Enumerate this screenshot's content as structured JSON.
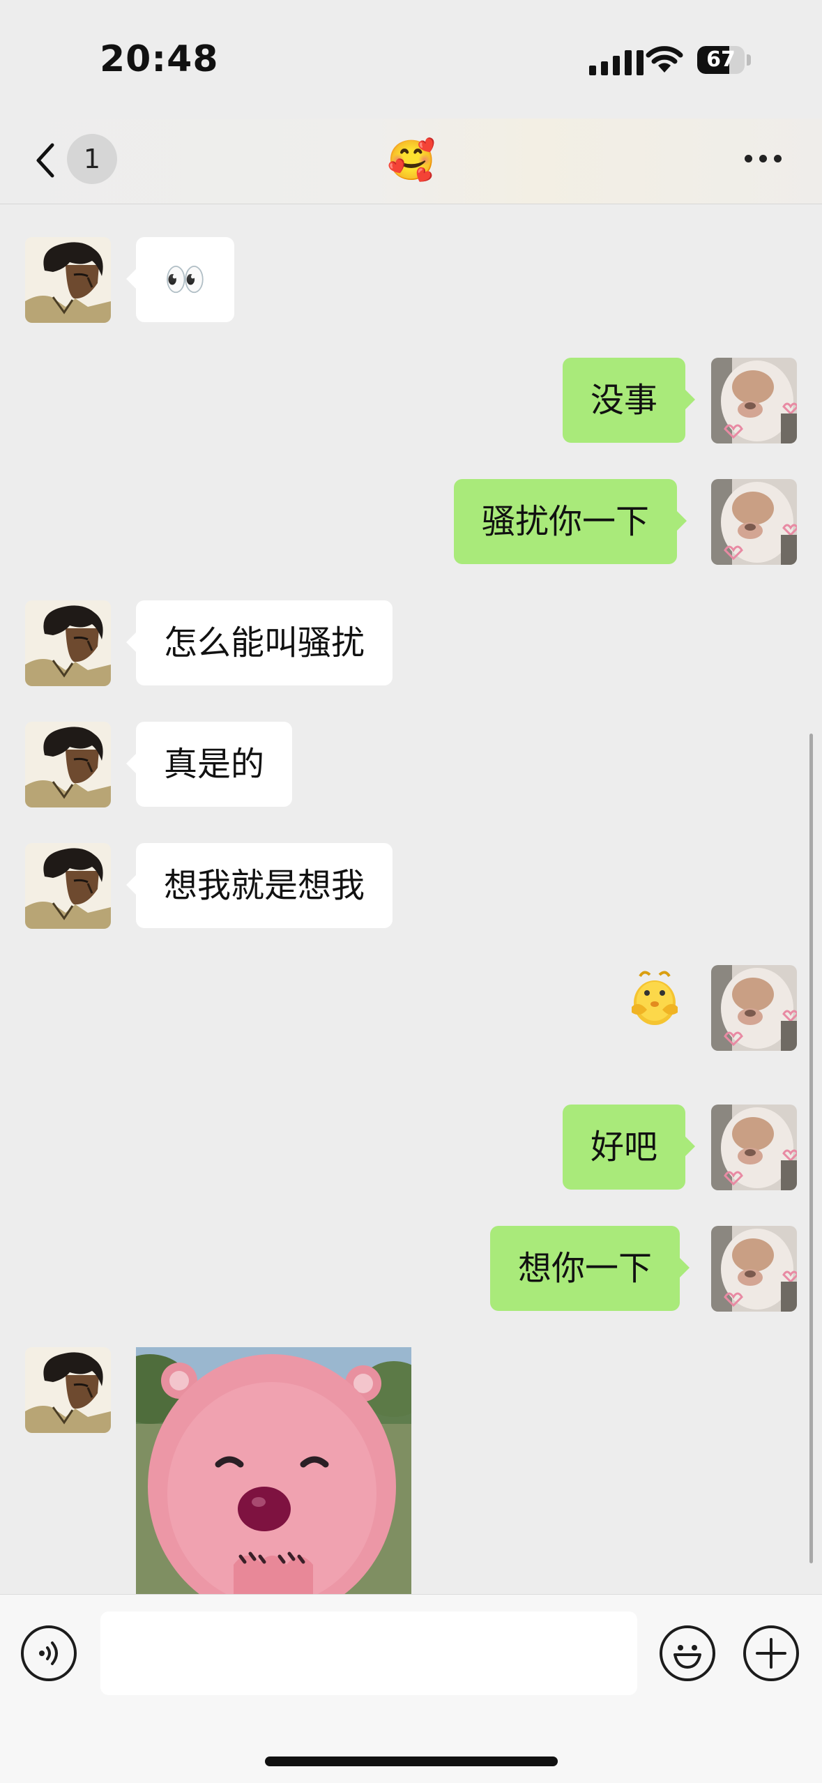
{
  "status_bar": {
    "time": "20:48",
    "battery": "67",
    "battery_level": 0.67
  },
  "nav": {
    "unread_count": "1",
    "title": "🥰",
    "back_icon": "chevron-left-icon",
    "more_icon": "more-dots-icon"
  },
  "messages": [
    {
      "side": "in",
      "text": "👀"
    },
    {
      "side": "out",
      "text": "没事"
    },
    {
      "side": "out",
      "text": "骚扰你一下"
    },
    {
      "side": "in",
      "text": "怎么能叫骚扰"
    },
    {
      "side": "in",
      "text": "真是的"
    },
    {
      "side": "in",
      "text": "想我就是想我"
    },
    {
      "side": "out",
      "type": "sticker",
      "sticker": "thinking-chick-sticker"
    },
    {
      "side": "out",
      "text": "好吧"
    },
    {
      "side": "out",
      "text": "想你一下"
    },
    {
      "side": "in",
      "type": "sticker",
      "sticker": "pink-beaver-sticker"
    }
  ],
  "input_bar": {
    "voice_icon": "voice-icon",
    "emoji_icon": "emoji-icon",
    "plus_icon": "plus-icon",
    "input_value": ""
  },
  "colors": {
    "background": "#ededed",
    "outgoing_bubble": "#a9ea7a",
    "incoming_bubble": "#ffffff"
  }
}
